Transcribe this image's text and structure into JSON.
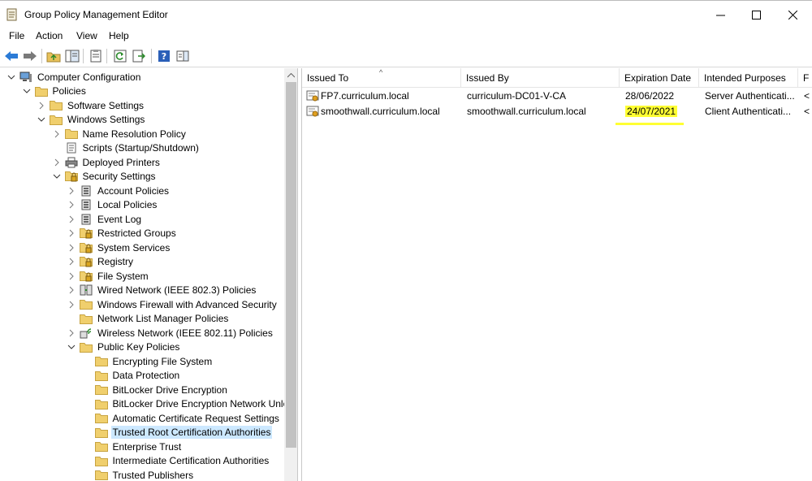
{
  "window": {
    "title": "Group Policy Management Editor"
  },
  "menu": {
    "file": "File",
    "action": "Action",
    "view": "View",
    "help": "Help"
  },
  "toolbar": {
    "icons": [
      "back-icon",
      "forward-icon",
      "up-folder-icon",
      "show-hide-tree-icon",
      "properties-icon",
      "refresh-icon",
      "export-list-icon",
      "help-icon",
      "show-action-pane-icon"
    ]
  },
  "tree": {
    "items": [
      {
        "label": "Computer Configuration"
      },
      {
        "label": "Policies"
      },
      {
        "label": "Software Settings"
      },
      {
        "label": "Windows Settings"
      },
      {
        "label": "Name Resolution Policy"
      },
      {
        "label": "Scripts (Startup/Shutdown)"
      },
      {
        "label": "Deployed Printers"
      },
      {
        "label": "Security Settings"
      },
      {
        "label": "Account Policies"
      },
      {
        "label": "Local Policies"
      },
      {
        "label": "Event Log"
      },
      {
        "label": "Restricted Groups"
      },
      {
        "label": "System Services"
      },
      {
        "label": "Registry"
      },
      {
        "label": "File System"
      },
      {
        "label": "Wired Network (IEEE 802.3) Policies"
      },
      {
        "label": "Windows Firewall with Advanced Security"
      },
      {
        "label": "Network List Manager Policies"
      },
      {
        "label": "Wireless Network (IEEE 802.11) Policies"
      },
      {
        "label": "Public Key Policies"
      },
      {
        "label": "Encrypting File System"
      },
      {
        "label": "Data Protection"
      },
      {
        "label": "BitLocker Drive Encryption"
      },
      {
        "label": "BitLocker Drive Encryption Network Unlo"
      },
      {
        "label": "Automatic Certificate Request Settings"
      },
      {
        "label": "Trusted Root Certification Authorities"
      },
      {
        "label": "Enterprise Trust"
      },
      {
        "label": "Intermediate Certification Authorities"
      },
      {
        "label": "Trusted Publishers"
      }
    ]
  },
  "list": {
    "columns": [
      "Issued To",
      "Issued By",
      "Expiration Date",
      "Intended Purposes",
      "F"
    ],
    "rows": [
      {
        "issued_to": "FP7.curriculum.local",
        "issued_by": "curriculum-DC01-V-CA",
        "expiration": "28/06/2022",
        "purposes": "Server Authenticati...",
        "extra": "<"
      },
      {
        "issued_to": "smoothwall.curriculum.local",
        "issued_by": "smoothwall.curriculum.local",
        "expiration": "24/07/2021",
        "purposes": "Client Authenticati...",
        "extra": "<"
      }
    ]
  },
  "colors": {
    "selection": "#cce8ff",
    "highlight": "#ffff33",
    "folder": "#e8c15a"
  }
}
